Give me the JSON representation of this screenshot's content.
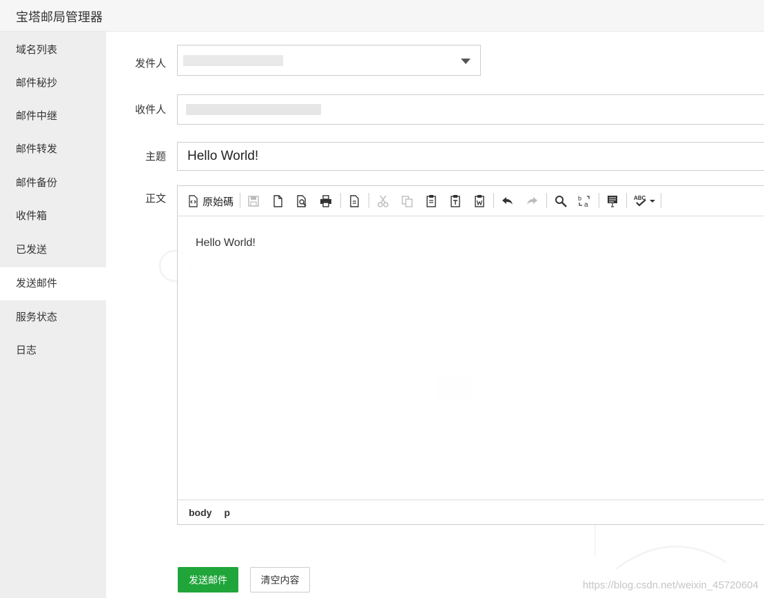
{
  "app": {
    "title": "宝塔邮局管理器"
  },
  "sidebar": {
    "items": [
      {
        "label": "域名列表"
      },
      {
        "label": "邮件秘抄"
      },
      {
        "label": "邮件中继"
      },
      {
        "label": "邮件转发"
      },
      {
        "label": "邮件备份"
      },
      {
        "label": "收件箱"
      },
      {
        "label": "已发送"
      },
      {
        "label": "发送邮件",
        "active": true
      },
      {
        "label": "服务状态"
      },
      {
        "label": "日志"
      }
    ]
  },
  "form": {
    "sender_label": "发件人",
    "recipient_label": "收件人",
    "subject_label": "主题",
    "subject_value": "Hello World!",
    "body_label": "正文"
  },
  "editor": {
    "toolbar": {
      "source_label": "原始碼",
      "icons": [
        "source-icon",
        "save-icon",
        "new-document-icon",
        "preview-icon",
        "print-icon",
        "templates-icon",
        "cut-icon",
        "copy-icon",
        "paste-icon",
        "paste-text-icon",
        "paste-word-icon",
        "undo-icon",
        "redo-icon",
        "find-icon",
        "replace-icon",
        "select-all-icon",
        "spellcheck-icon"
      ]
    },
    "content": "Hello World!",
    "path": [
      "body",
      "p"
    ]
  },
  "actions": {
    "send_label": "发送邮件",
    "clear_label": "清空内容"
  },
  "watermark": "https://blog.csdn.net/weixin_45720604",
  "colors": {
    "primary": "#20a53a",
    "sidebar_bg": "#eeeeee"
  }
}
